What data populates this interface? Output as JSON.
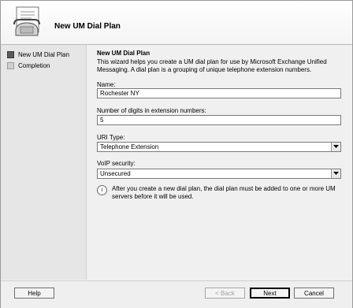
{
  "header": {
    "title": "New UM Dial Plan"
  },
  "nav": {
    "items": [
      {
        "label": "New UM Dial Plan"
      },
      {
        "label": "Completion"
      }
    ]
  },
  "main": {
    "section_title": "New UM Dial Plan",
    "description": "This wizard helps you create a UM dial plan for use by Microsoft Exchange Unified Messaging. A dial plan is a grouping of unique telephone extension numbers.",
    "fields": {
      "name": {
        "label": "Name:",
        "value": "Rochester NY"
      },
      "digits": {
        "label": "Number of digits in extension numbers:",
        "value": "5"
      },
      "uri_type": {
        "label": "URI Type:",
        "value": "Telephone Extension"
      },
      "voip_security": {
        "label": "VoIP security:",
        "value": "Unsecured"
      }
    },
    "note": "After you create a new dial plan, the dial plan must be added to one or more UM servers before it will be used."
  },
  "buttons": {
    "help": "Help",
    "back": "< Back",
    "next": "Next",
    "cancel": "Cancel"
  },
  "icons": {
    "header": "telephone-document-icon",
    "info": "info-icon",
    "dropdown": "chevron-down-icon"
  }
}
